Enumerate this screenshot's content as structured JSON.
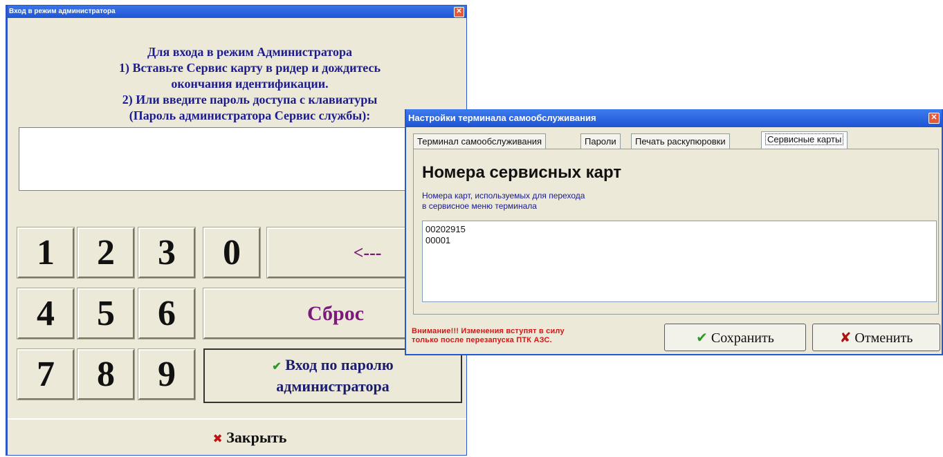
{
  "admin_window": {
    "title": "Вход в режим администратора",
    "close_icon": "close-icon",
    "instructions": [
      "Для входа в режим Администратора",
      "1) Вставьте Сервис карту в ридер и дождитесь",
      "окончания идентификации.",
      "2) Или введите пароль доступа с клавиатуры",
      "(Пароль администратора Сервис службы):"
    ],
    "password_value": "",
    "keypad": {
      "k1": "1",
      "k2": "2",
      "k3": "3",
      "k0": "0",
      "k4": "4",
      "k5": "5",
      "k6": "6",
      "k7": "7",
      "k8": "8",
      "k9": "9",
      "backspace": "<---",
      "reset": "Сброс"
    },
    "login_button": {
      "line1": "Вход по паролю",
      "line2": "администратора",
      "icon": "check-icon"
    },
    "close_button": {
      "label": "Закрыть",
      "icon": "x-icon"
    }
  },
  "settings_window": {
    "title": "Настройки терминала самообслуживания",
    "close_icon": "close-icon",
    "tabs": [
      "Терминал самообслуживания",
      "Пароли",
      "Печать раскупюровки",
      "Сервисные карты"
    ],
    "active_tab": "Сервисные карты",
    "heading": "Номера сервисных карт",
    "description": [
      "Номера карт, используемых для перехода",
      "в сервисное меню терминала"
    ],
    "card_numbers": [
      "00202915",
      "00001"
    ],
    "warning": [
      "Внимание!!! Изменения вступят в силу",
      "только после перезапуска ПТК АЗС."
    ],
    "save_button": {
      "label": "Сохранить",
      "icon": "check-icon"
    },
    "cancel_button": {
      "label": "Отменить",
      "icon": "x-icon"
    }
  },
  "colors": {
    "titlebar": "#1f56d6",
    "window_bg": "#ece9d8",
    "instruction_text": "#1c1c8f",
    "accent_purple": "#7a1a7a",
    "warning_red": "#d01818"
  }
}
